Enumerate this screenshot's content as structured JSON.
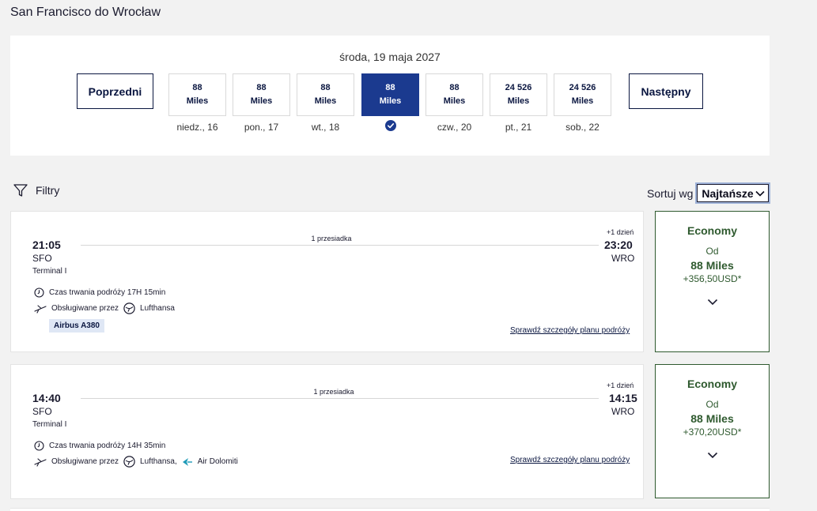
{
  "route_title": "San Francisco do Wrocław",
  "date_panel": {
    "selected_date": "środa, 19 maja 2027",
    "prev_label": "Poprzedni",
    "next_label": "Następny",
    "days": [
      {
        "amount": "88",
        "unit": "Miles",
        "label": "niedz., 16"
      },
      {
        "amount": "88",
        "unit": "Miles",
        "label": "pon., 17"
      },
      {
        "amount": "88",
        "unit": "Miles",
        "label": "wt., 18"
      },
      {
        "amount": "88",
        "unit": "Miles",
        "label": "",
        "selected": true
      },
      {
        "amount": "88",
        "unit": "Miles",
        "label": "czw., 20"
      },
      {
        "amount": "24 526",
        "unit": "Miles",
        "label": "pt., 21"
      },
      {
        "amount": "24 526",
        "unit": "Miles",
        "label": "sob., 22"
      }
    ]
  },
  "filters_label": "Filtry",
  "sort": {
    "label": "Sortuj wg",
    "value": "Najtańsze"
  },
  "flights": [
    {
      "dep_time": "21:05",
      "dep_code": "SFO",
      "dep_terminal": "Terminal I",
      "stops": "1 przesiadka",
      "plus_day": "+1 dzień",
      "arr_time": "23:20",
      "arr_code": "WRO",
      "duration": "Czas trwania podróży 17H 15min",
      "operated_prefix": "Obsługiwane przez",
      "operators": "Lufthansa",
      "aircraft": "Airbus A380",
      "details_link": "Sprawdź szczegóły planu podróży",
      "fare": {
        "class": "Economy",
        "from": "Od",
        "miles": "88 Miles",
        "tax": "+356,50USD*"
      }
    },
    {
      "dep_time": "14:40",
      "dep_code": "SFO",
      "dep_terminal": "Terminal I",
      "stops": "1 przesiadka",
      "plus_day": "+1 dzień",
      "arr_time": "14:15",
      "arr_code": "WRO",
      "duration": "Czas trwania podróży 14H 35min",
      "operated_prefix": "Obsługiwane przez",
      "operators": "Lufthansa,",
      "operators_2": "Air Dolomiti",
      "details_link": "Sprawdź szczegóły planu podróży",
      "fare": {
        "class": "Economy",
        "from": "Od",
        "miles": "88 Miles",
        "tax": "+370,20USD*"
      }
    }
  ],
  "colors": {
    "brand_navy": "#0a1640",
    "selected_blue": "#1b3a8f",
    "fare_green": "#2f5a2f"
  }
}
